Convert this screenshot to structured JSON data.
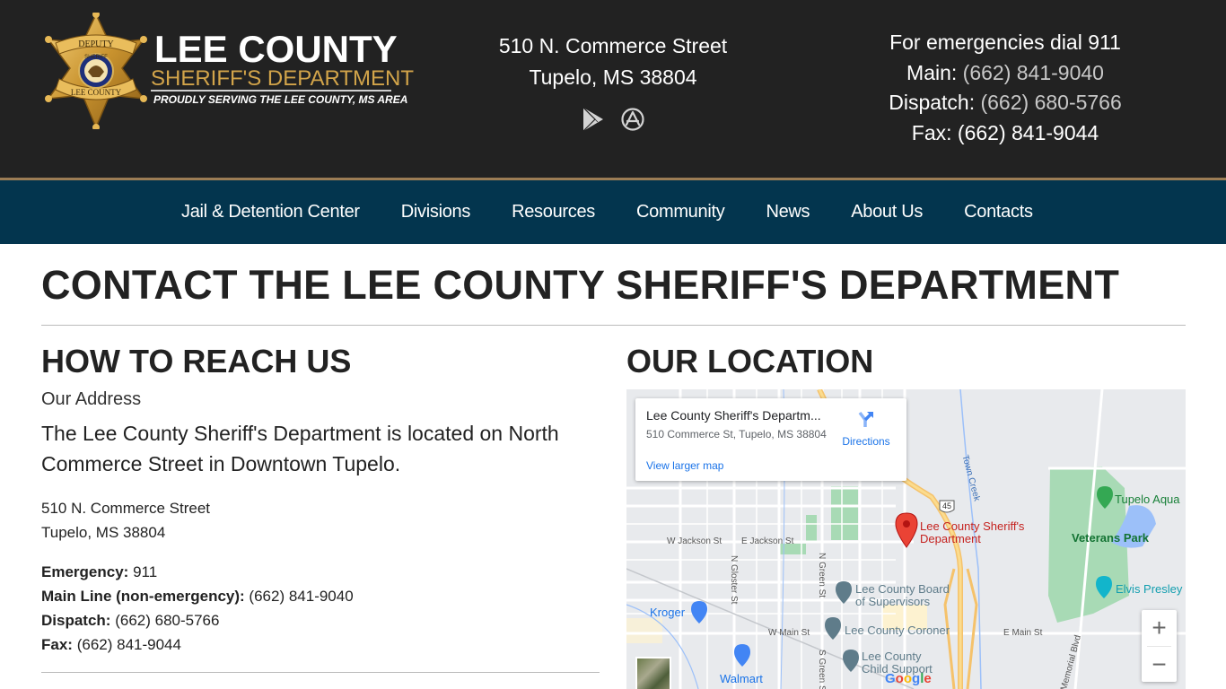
{
  "header": {
    "logo": {
      "title": "LEE COUNTY",
      "subtitle": "SHERIFF'S DEPARTMENT",
      "tagline": "PROUDLY SERVING THE LEE COUNTY, MS AREA",
      "badge_top": "DEPUTY",
      "badge_mid": "SHERIFF",
      "badge_bottom": "LEE COUNTY",
      "badge_seal": "STATE OF MISSISSIPPI"
    },
    "address": {
      "line1": "510 N. Commerce Street",
      "line2": "Tupelo, MS 38804"
    },
    "app_icons": [
      {
        "name": "google-play",
        "icon": "play-store-icon"
      },
      {
        "name": "app-store",
        "icon": "app-store-icon"
      }
    ],
    "contacts": {
      "emergency": "For emergencies dial 911",
      "main_label": "Main:",
      "main_phone": "(662) 841-9040",
      "dispatch_label": "Dispatch:",
      "dispatch_phone": "(662) 680-5766",
      "fax_label": "Fax:",
      "fax_phone": "(662) 841-9044"
    },
    "colors": {
      "header_bg": "#222222",
      "accent_gold": "#d2a44a",
      "rule_gold": "#9c7d55",
      "nav_bg": "#03354e"
    }
  },
  "nav": {
    "items": [
      {
        "label": "Jail & Detention Center"
      },
      {
        "label": "Divisions"
      },
      {
        "label": "Resources"
      },
      {
        "label": "Community"
      },
      {
        "label": "News"
      },
      {
        "label": "About Us"
      },
      {
        "label": "Contacts"
      }
    ]
  },
  "main": {
    "page_title": "CONTACT THE LEE COUNTY SHERIFF'S DEPARTMENT",
    "reach": {
      "heading": "HOW TO REACH US",
      "our_address": "Our Address",
      "lead": "The Lee County Sheriff's Department is located on North Commerce Street in Downtown Tupelo.",
      "address_line1": "510 N. Commerce Street",
      "address_line2": "Tupelo, MS 38804",
      "phones": [
        {
          "label": "Emergency:",
          "value": "911"
        },
        {
          "label": "Main Line (non-emergency):",
          "value": "(662) 841-9040"
        },
        {
          "label": "Dispatch:",
          "value": "(662) 680-5766"
        },
        {
          "label": "Fax:",
          "value": "(662) 841-9044"
        }
      ]
    },
    "location": {
      "heading": "OUR LOCATION",
      "map": {
        "card_title": "Lee County Sheriff's Departm...",
        "card_address": "510 Commerce St, Tupelo, MS 38804",
        "directions": "Directions",
        "view_larger": "View larger map",
        "zoom_in": "+",
        "zoom_out": "−",
        "google": "Google",
        "streets": {
          "w_jackson": "W Jackson St",
          "e_jackson": "E Jackson St",
          "n_gloster": "N Gloster St",
          "n_green": "N Green St",
          "s_green": "S Green St",
          "w_main": "W Main St",
          "e_main": "E Main St",
          "town_creek": "Town Creek",
          "memorial": "Memorial Blvd",
          "us45": "45"
        },
        "pois": {
          "sheriff_line1": "Lee County Sheriff's",
          "sheriff_line2": "Department",
          "board_line1": "Lee County Board",
          "board_line2": "of Supervisors",
          "coroner": "Lee County Coroner",
          "child_line1": "Lee County",
          "child_line2": "Child Support",
          "kroger": "Kroger",
          "walmart": "Walmart",
          "aquarium": "Tupelo Aqua",
          "veterans": "Veterans Park",
          "elvis": "Elvis Presley"
        }
      }
    }
  }
}
